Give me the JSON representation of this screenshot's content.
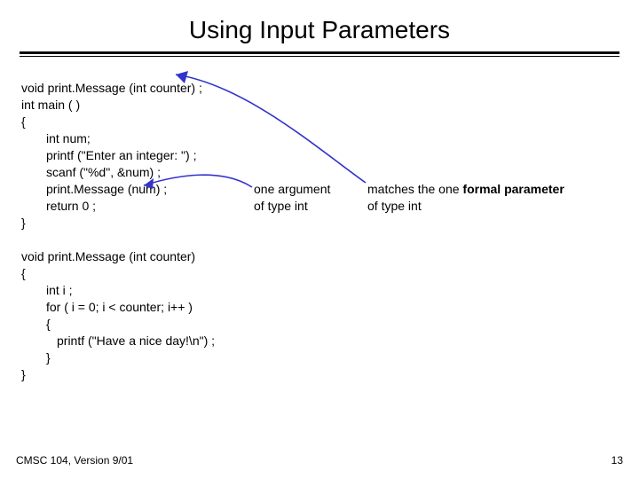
{
  "title": "Using Input Parameters",
  "code": {
    "l1": "void print.Message (int counter) ;",
    "l2": "int main ( )",
    "l3": "{",
    "l4": "int num;",
    "l5": "printf (\"Enter an integer: \") ;",
    "l6": "scanf (\"%d\", &num) ;",
    "l7": "print.Message (num) ;",
    "l8": "return 0 ;",
    "l9": "}",
    "l10": "void print.Message (int counter)",
    "l11": "{",
    "l12": "int i ;",
    "l13": "for ( i = 0; i < counter; i++ )",
    "l14": "{",
    "l15": "printf (\"Have a nice day!\\n\") ;",
    "l16": "}",
    "l17": "}"
  },
  "annot": {
    "left_l1": "one argument",
    "left_l2": "of  type int",
    "right_pre": "matches the one ",
    "right_bold": "formal parameter",
    "right_l2": "of type int"
  },
  "footer": {
    "left": "CMSC 104, Version 9/01",
    "right": "13"
  }
}
